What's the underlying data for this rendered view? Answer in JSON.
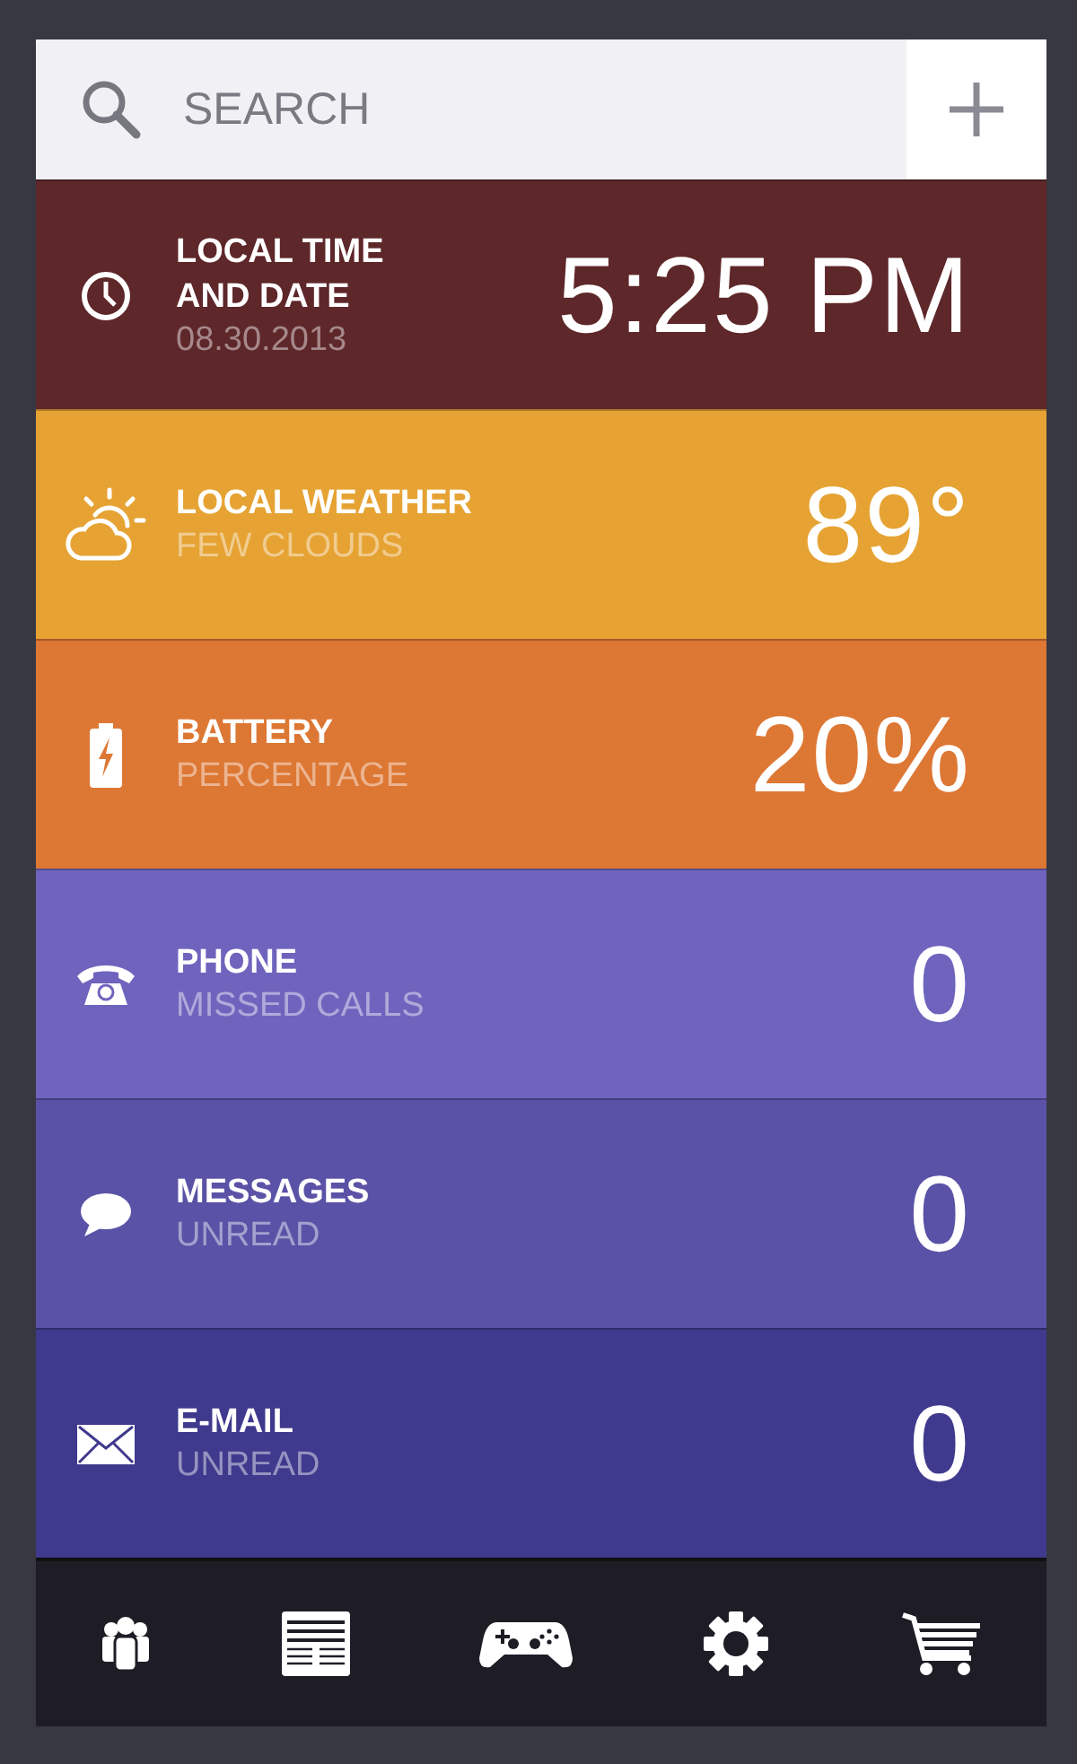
{
  "search": {
    "placeholder": "SEARCH"
  },
  "cards": [
    {
      "kind": "clock",
      "title": "LOCAL TIME\nAND DATE",
      "subtitle": "08.30.2013",
      "value": "5:25 PM",
      "color": "#5e272a"
    },
    {
      "kind": "weather",
      "title": "LOCAL WEATHER",
      "subtitle": "FEW CLOUDS",
      "value": "89°",
      "color": "#e6a334"
    },
    {
      "kind": "battery",
      "title": "BATTERY",
      "subtitle": "PERCENTAGE",
      "value": "20%",
      "color": "#dd7734"
    },
    {
      "kind": "phone",
      "title": "PHONE",
      "subtitle": "MISSED CALLS",
      "value": "0",
      "color": "#6f64bd"
    },
    {
      "kind": "chat",
      "title": "MESSAGES",
      "subtitle": "UNREAD",
      "value": "0",
      "color": "#5a52a6"
    },
    {
      "kind": "mail",
      "title": "E-MAIL",
      "subtitle": "UNREAD",
      "value": "0",
      "color": "#3f3a8d"
    }
  ],
  "nav": [
    {
      "kind": "people"
    },
    {
      "kind": "news"
    },
    {
      "kind": "game"
    },
    {
      "kind": "settings"
    },
    {
      "kind": "cart"
    }
  ]
}
